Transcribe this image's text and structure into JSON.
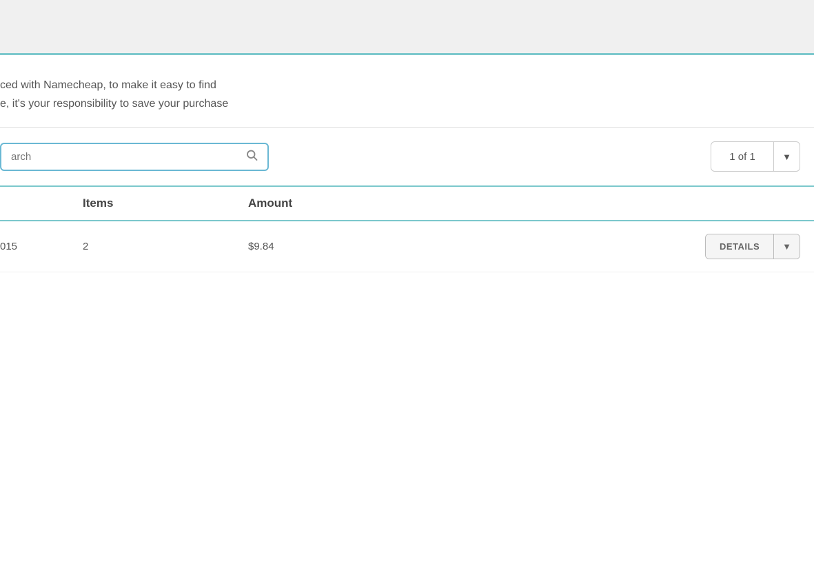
{
  "colors": {
    "accent": "#7cc8cc",
    "border": "#ccc",
    "text_primary": "#444",
    "text_secondary": "#555",
    "text_muted": "#888"
  },
  "topbar": {},
  "description": {
    "line1": "ced with Namecheap, to make it easy to find",
    "line2": "e, it's your responsibility to save your purchase"
  },
  "search": {
    "placeholder": "arch",
    "value": ""
  },
  "pagination": {
    "label": "1 of 1",
    "arrow": "▼"
  },
  "table": {
    "headers": {
      "order": "",
      "items": "Items",
      "amount": "Amount",
      "actions": ""
    },
    "rows": [
      {
        "order": "015",
        "items": "2",
        "amount": "$9.84",
        "details_label": "DETAILS",
        "details_arrow": "▼"
      }
    ]
  },
  "buttons": {
    "details_main": "DETAILS",
    "details_arrow": "▼",
    "pagination_arrow": "▼"
  }
}
